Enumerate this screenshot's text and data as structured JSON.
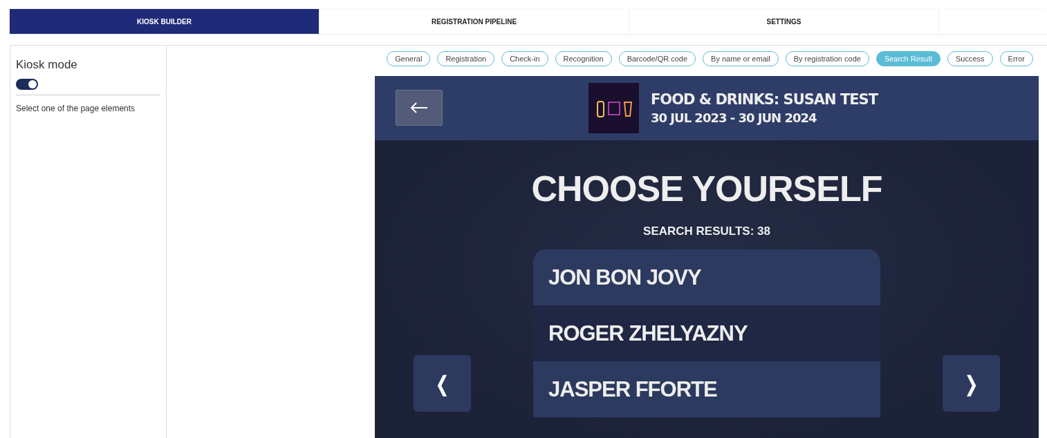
{
  "tabs": [
    {
      "label": "KIOSK BUILDER",
      "selected": true
    },
    {
      "label": "REGISTRATION PIPELINE",
      "selected": false
    },
    {
      "label": "SETTINGS",
      "selected": false
    }
  ],
  "sidebar": {
    "title": "Kiosk mode",
    "kiosk_mode_on": true,
    "hint": "Select one of the page elements"
  },
  "page_tabs": [
    {
      "label": "General",
      "selected": false
    },
    {
      "label": "Registration",
      "selected": false
    },
    {
      "label": "Check-in",
      "selected": false
    },
    {
      "label": "Recognition",
      "selected": false
    },
    {
      "label": "Barcode/QR code",
      "selected": false
    },
    {
      "label": "By name or email",
      "selected": false
    },
    {
      "label": "By registration code",
      "selected": false
    },
    {
      "label": "Search Result",
      "selected": true
    },
    {
      "label": "Success",
      "selected": false
    },
    {
      "label": "Error",
      "selected": false
    }
  ],
  "preview": {
    "event_title": "FOOD & DRINKS: SUSAN TEST",
    "event_dates": "30 JUL 2023 - 30 JUN 2024",
    "heading": "CHOOSE YOURSELF",
    "results": "SEARCH RESULTS: 38",
    "names": [
      "JON BON JOVY",
      "ROGER ZHELYAZNY",
      "JASPER FFORTE"
    ],
    "prev": "❬",
    "next": "❭"
  }
}
